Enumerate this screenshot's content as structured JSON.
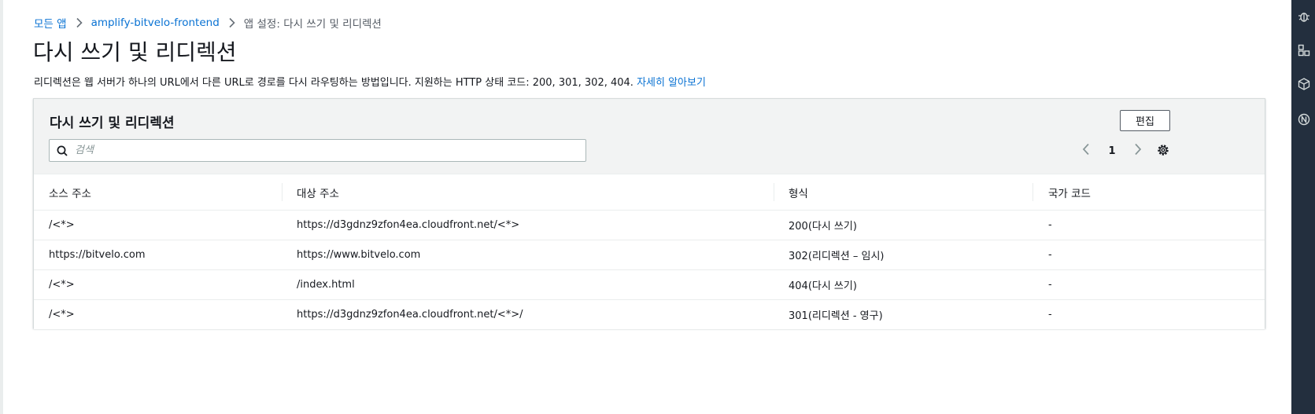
{
  "breadcrumb": {
    "items": [
      "모든 앱",
      "amplify-bitvelo-frontend"
    ],
    "current": "앱 설정: 다시 쓰기 및 리디렉션"
  },
  "page": {
    "title": "다시 쓰기 및 리디렉션",
    "description": "리디렉션은 웹 서버가 하나의 URL에서 다른 URL로 경로를 다시 라우팅하는 방법입니다. 지원하는 HTTP 상태 코드: 200, 301, 302, 404.",
    "learn_more": "자세히 알아보기"
  },
  "panel": {
    "title": "다시 쓰기 및 리디렉션",
    "edit_label": "편집",
    "search_placeholder": "검색",
    "page_number": "1"
  },
  "table": {
    "columns": [
      "소스 주소",
      "대상 주소",
      "형식",
      "국가 코드"
    ],
    "rows": [
      [
        "/<*>",
        "https://d3gdnz9zfon4ea.cloudfront.net/<*>",
        "200(다시 쓰기)",
        "-"
      ],
      [
        "https://bitvelo.com",
        "https://www.bitvelo.com",
        "302(리디렉션 – 임시)",
        "-"
      ],
      [
        "/<*>",
        "/index.html",
        "404(다시 쓰기)",
        "-"
      ],
      [
        "/<*>",
        "https://d3gdnz9zfon4ea.cloudfront.net/<*>/",
        "301(리디렉션 - 영구)",
        "-"
      ]
    ]
  },
  "icons": {
    "breadcrumb_separator": "chevron-right-icon",
    "search": "search-icon",
    "prev": "chevron-left-icon",
    "next": "chevron-right-icon",
    "settings": "gear-icon"
  },
  "colors": {
    "link": "#0972d3",
    "panel_header": "#f2f3f3",
    "side_nav": "#232f3e"
  }
}
